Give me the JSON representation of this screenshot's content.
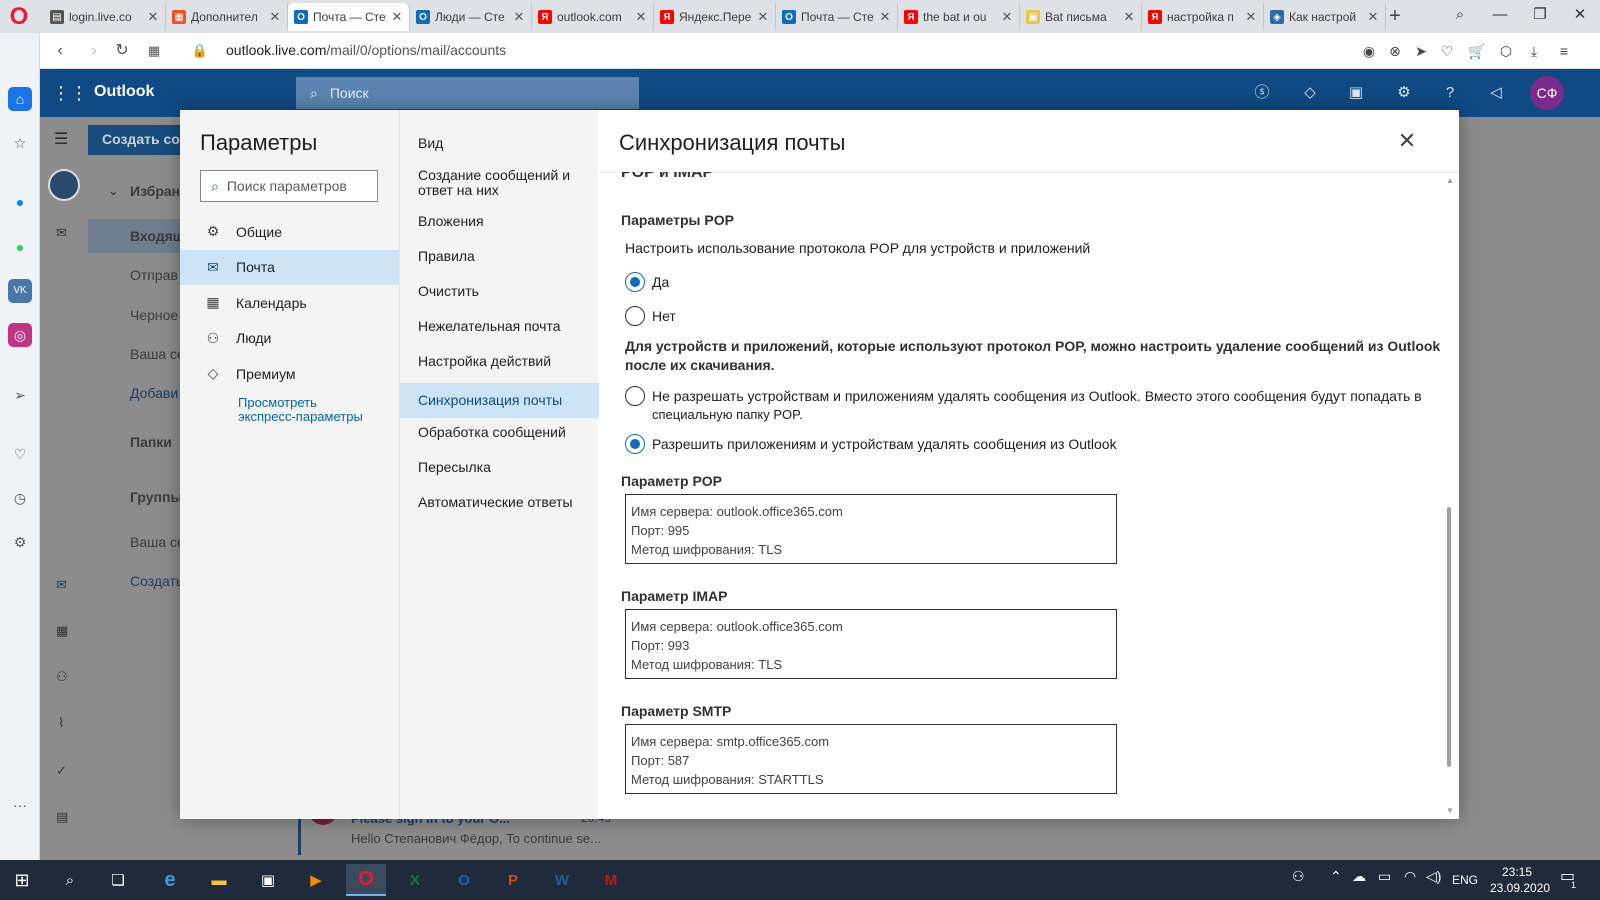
{
  "browser": {
    "tabs": [
      {
        "title": "login.live.co",
        "fav": "doc",
        "color": "#555555"
      },
      {
        "title": "Дополнител",
        "fav": "ms",
        "color": "#f25022"
      },
      {
        "title": "Почта — Сте",
        "fav": "outlook",
        "color": "#0f6cbd",
        "active": true
      },
      {
        "title": "Люди — Сте",
        "fav": "outlook",
        "color": "#0f6cbd"
      },
      {
        "title": "outlook.com",
        "fav": "yandex",
        "color": "#ff0000"
      },
      {
        "title": "Яндекс.Пере",
        "fav": "yandex",
        "color": "#ff0000"
      },
      {
        "title": "Почта — Сте",
        "fav": "outlook",
        "color": "#0f6cbd"
      },
      {
        "title": "the bat и ou",
        "fav": "yandex",
        "color": "#ff0000"
      },
      {
        "title": "Bat письма",
        "fav": "bat",
        "color": "#e7c44a"
      },
      {
        "title": "настройка п",
        "fav": "yandex",
        "color": "#ff0000"
      },
      {
        "title": "Как настрой",
        "fav": "howto",
        "color": "#2c6da6"
      }
    ],
    "new_tab": "+",
    "url_host": "outlook.live.com",
    "url_path": "/mail/0/options/mail/accounts"
  },
  "outlook": {
    "brand": "Outlook",
    "search_placeholder": "Поиск",
    "avatar_initials": "СФ",
    "create_button": "Создать со",
    "folders": {
      "favorites": "Избран",
      "inbox": "Входящ",
      "sent": "Отправ",
      "drafts": "Черное",
      "your": "Ваша се",
      "add": "Добави",
      "folders": "Папки",
      "groups": "Группы",
      "group_your": "Ваша се",
      "group_create": "Создать"
    },
    "message": {
      "subject": "Please sign in to your O...",
      "time": "20:45",
      "preview": "Hello Степанович Фёдор, To continue se..."
    }
  },
  "settings": {
    "title": "Параметры",
    "search_placeholder": "Поиск параметров",
    "left_nav": [
      {
        "label": "Общие",
        "icon": "gear-icon"
      },
      {
        "label": "Почта",
        "icon": "mail-icon",
        "selected": true
      },
      {
        "label": "Календарь",
        "icon": "calendar-icon"
      },
      {
        "label": "Люди",
        "icon": "people-icon"
      },
      {
        "label": "Премиум",
        "icon": "diamond-icon"
      }
    ],
    "quick_link": "Просмотреть экспресс-параметры",
    "mid_nav": [
      {
        "label": "Вид"
      },
      {
        "label": "Создание сообщений и ответ на них"
      },
      {
        "label": "Вложения"
      },
      {
        "label": "Правила"
      },
      {
        "label": "Очистить"
      },
      {
        "label": "Нежелательная почта"
      },
      {
        "label": "Настройка действий"
      },
      {
        "label": "Синхронизация почты",
        "selected": true
      },
      {
        "label": "Обработка сообщений"
      },
      {
        "label": "Пересылка"
      },
      {
        "label": "Автоматические ответы"
      }
    ]
  },
  "sync": {
    "title": "Синхронизация почты",
    "section_cut": "POP и IMAP",
    "pop_header": "Параметры POP",
    "pop_question": "Настроить использование протокола POP для устройств и приложений",
    "opt_yes": "Да",
    "opt_no": "Нет",
    "delete_question_1": "Для устройств и приложений, которые используют протокол POP, можно настроить удаление сообщений из Outlook",
    "delete_question_2": "после их скачивания.",
    "opt_keep_1": "Не разрешать устройствам и приложениям удалять сообщения из Outlook. Вместо этого сообщения будут попадать в",
    "opt_keep_2": "специальную папку POP.",
    "opt_allow": "Разрешить приложениям и устройствам удалять сообщения из Outlook",
    "pop": {
      "label": "Параметр POP",
      "server": "Имя сервера: outlook.office365.com",
      "port": "Порт: 995",
      "enc": "Метод шифрования: TLS"
    },
    "imap": {
      "label": "Параметр IMAP",
      "server": "Имя сервера: outlook.office365.com",
      "port": "Порт: 993",
      "enc": "Метод шифрования: TLS"
    },
    "smtp": {
      "label": "Параметр SMTP",
      "server": "Имя сервера: smtp.office365.com",
      "port": "Порт: 587",
      "enc": "Метод шифрования: STARTTLS"
    }
  },
  "taskbar": {
    "lang": "ENG",
    "time": "23:15",
    "date": "23.09.2020",
    "notif_count": "1"
  }
}
